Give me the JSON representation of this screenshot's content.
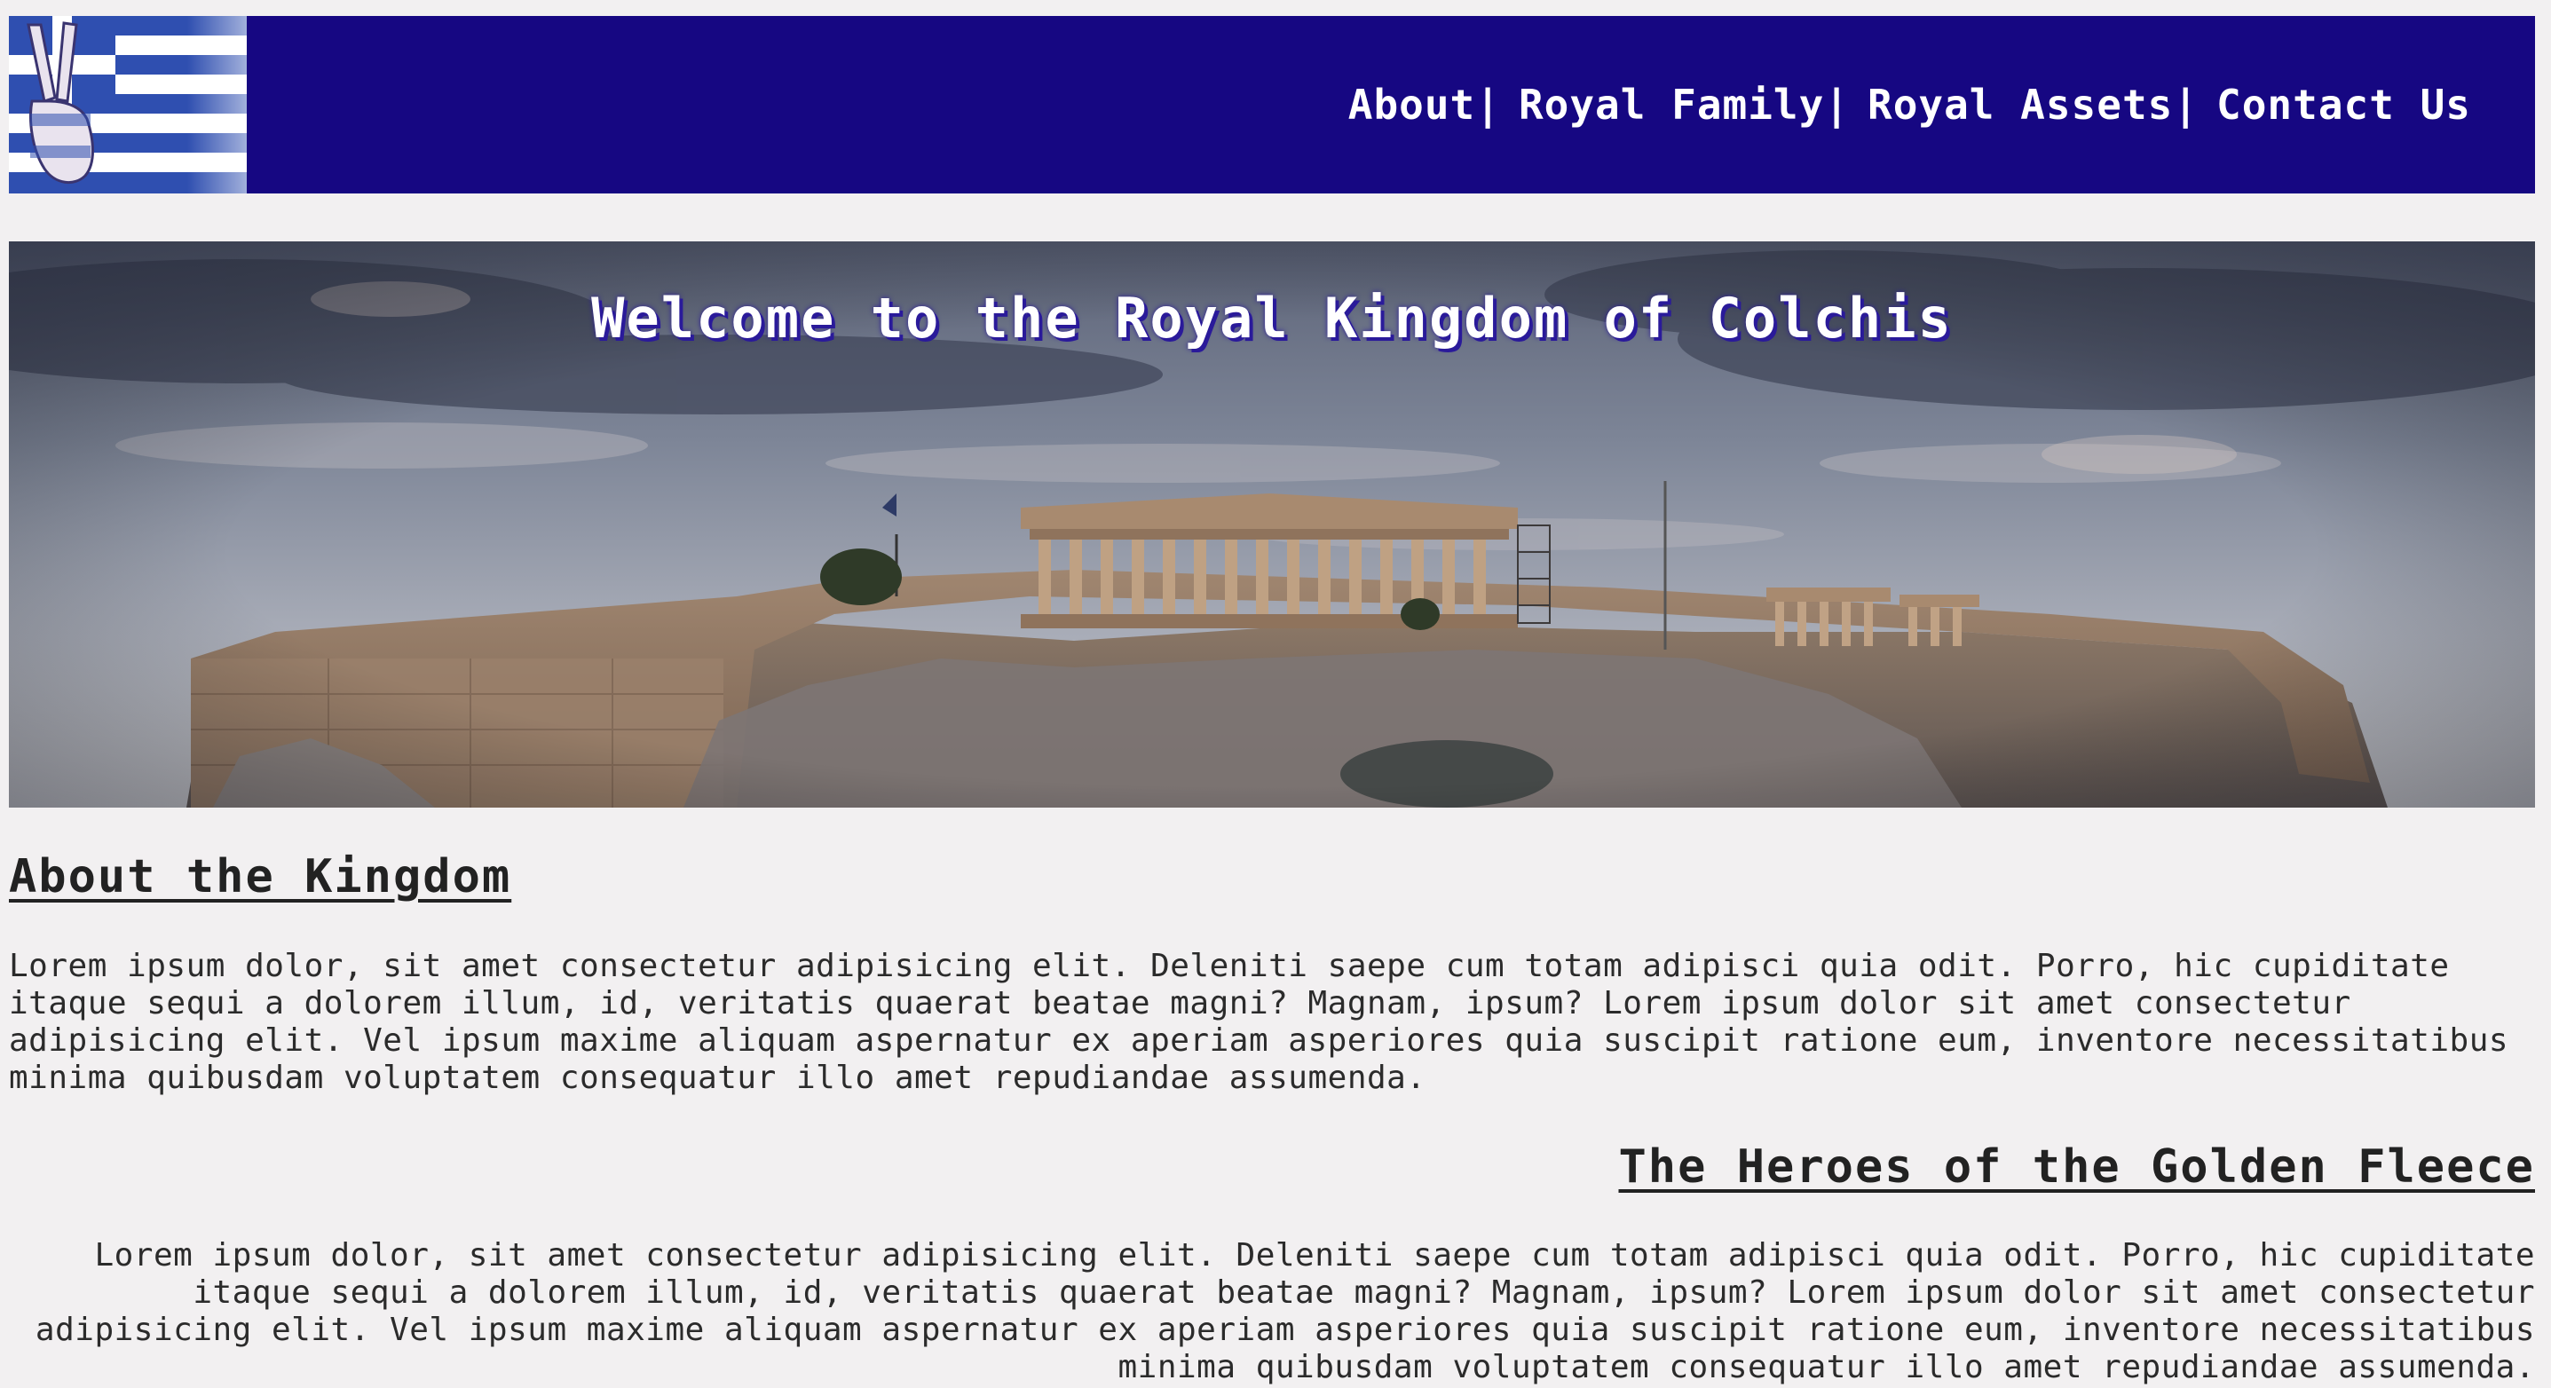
{
  "header": {
    "logo_icon": "greek-flag-peace-sign-icon",
    "nav": [
      {
        "label": "About",
        "separator": "|"
      },
      {
        "label": "Royal Family",
        "separator": "|"
      },
      {
        "label": "Royal Assets",
        "separator": "|"
      },
      {
        "label": "Contact Us",
        "separator": ""
      }
    ]
  },
  "hero": {
    "title": "Welcome to the Royal Kingdom of Colchis",
    "image": "acropolis-panorama-image"
  },
  "sections": {
    "about": {
      "heading": "About the Kingdom",
      "body": "Lorem ipsum dolor, sit amet consectetur adipisicing elit. Deleniti saepe cum totam adipisci quia odit. Porro, hic cupiditate itaque sequi a dolorem illum, id, veritatis quaerat beatae magni? Magnam, ipsum? Lorem ipsum dolor sit amet consectetur adipisicing elit. Vel ipsum maxime aliquam aspernatur ex aperiam asperiores quia suscipit ratione eum, inventore necessitatibus minima quibusdam voluptatem consequatur illo amet repudiandae assumenda."
    },
    "heroes": {
      "heading": "The Heroes of the Golden Fleece",
      "body": "Lorem ipsum dolor, sit amet consectetur adipisicing elit. Deleniti saepe cum totam adipisci quia odit. Porro, hic cupiditate itaque sequi a dolorem illum, id, veritatis quaerat beatae magni? Magnam, ipsum? Lorem ipsum dolor sit amet consectetur adipisicing elit. Vel ipsum maxime aliquam aspernatur ex aperiam asperiores quia suscipit ratione eum, inventore necessitatibus minima quibusdam voluptatem consequatur illo amet repudiandae assumenda."
    }
  },
  "colors": {
    "page_background": "#f2f0f1",
    "header_background": "#160782",
    "nav_text": "#ffffff",
    "heading_text": "#222222"
  }
}
